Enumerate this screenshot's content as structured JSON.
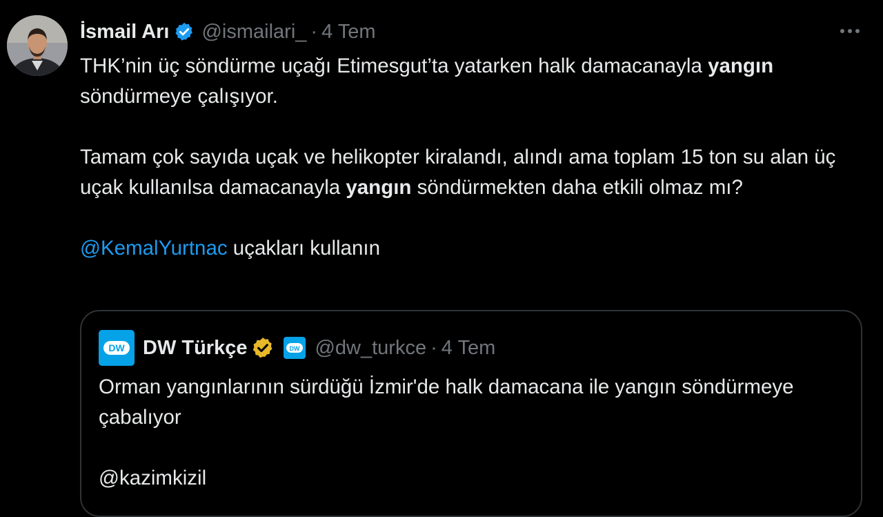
{
  "author": {
    "name": "İsmail Arı",
    "handle": "@ismailari_",
    "separator": "·",
    "date": "4 Tem",
    "avatar_icon": "user-avatar",
    "verified_icon": "verified-badge-icon",
    "verified_color": "#1d9bf0"
  },
  "more_icon": "more-options-icon",
  "tweet": {
    "p1_a": "THK’nin üç söndürme uçağı Etimesgut’ta yatarken halk damacanayla ",
    "p1_b": "yangın",
    "p1_c": " söndürmeye çalışıyor.",
    "p2_a": "Tamam çok sayıda uçak ve helikopter kiralandı, alındı ama toplam 15 ton su alan üç uçak kullanılsa damacanayla ",
    "p2_b": "yangın",
    "p2_c": " söndürmekten daha etkili olmaz mı?",
    "mention": "@KemalYurtnac",
    "p3_rest": " uçakları kullanın"
  },
  "quoted": {
    "name": "DW Türkçe",
    "handle": "@dw_turkce",
    "separator": "·",
    "date": "4 Tem",
    "logo_icon": "dw-logo",
    "verified_icon": "gold-verified-badge-icon",
    "verified_color": "#e8b829",
    "affiliate_icon": "dw-affiliate-badge-icon",
    "brand_color": "#05a2e8",
    "text_line1": "Orman yangınlarının sürdüğü İzmir'de halk damacana ile yangın söndürmeye çabalıyor",
    "text_mention": "@kazimkizil"
  },
  "colors": {
    "background": "#000000",
    "text": "#e7e9ea",
    "muted": "#71767b",
    "link": "#1d9bf0",
    "border": "#2f3336"
  }
}
